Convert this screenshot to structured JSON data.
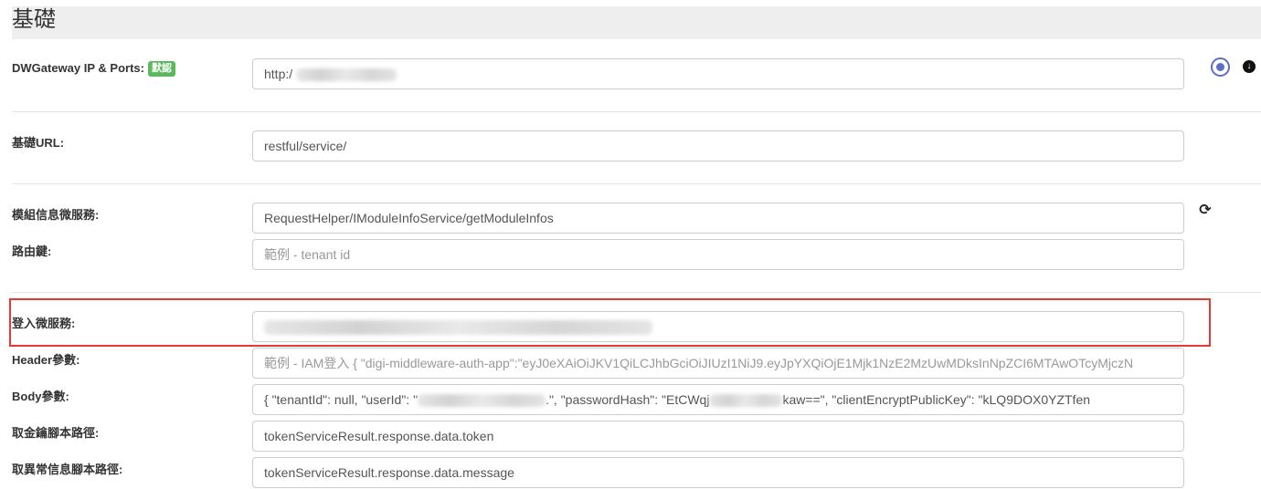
{
  "section": {
    "title": "基礎"
  },
  "rows": {
    "gateway": {
      "label": "DWGateway IP & Ports:",
      "badge": "默認",
      "value_prefix": "http:/"
    },
    "base_url": {
      "label": "基礎URL:",
      "value": "restful/service/"
    },
    "module_info": {
      "label": "模組信息微服務:",
      "value": "RequestHelper/IModuleInfoService/getModuleInfos"
    },
    "route_key": {
      "label": "路由鍵:",
      "placeholder": "範例 - tenant id"
    },
    "login": {
      "label": "登入微服務:"
    },
    "header_params": {
      "label": "Header參數:",
      "placeholder": "範例 - IAM登入 { \"digi-middleware-auth-app\":\"eyJ0eXAiOiJKV1QiLCJhbGciOiJIUzI1NiJ9.eyJpYXQiOjE1Mjk1NzE2MzUwMDksInNpZCI6MTAwOTcyMjczN"
    },
    "body_params": {
      "label": "Body參數:",
      "part1": "{   \"tenantId\": null,   \"userId\": \"",
      "part2": ".\",   \"passwordHash\": \"EtCWqj",
      "part3": "kaw==\",   \"clientEncryptPublicKey\": \"kLQ9DOX0YZTfen"
    },
    "token_path": {
      "label": "取金鑰腳本路徑:",
      "value": "tokenServiceResult.response.data.token"
    },
    "error_path": {
      "label": "取異常信息腳本路徑:",
      "value": "tokenServiceResult.response.data.message"
    }
  },
  "icons": {
    "radio": "radio-selected-icon",
    "download": "download-circle-icon",
    "refresh": "refresh-icon"
  },
  "colors": {
    "badge": "#5cb85c",
    "highlight": "#e53935",
    "radio": "#5b6dc8"
  }
}
